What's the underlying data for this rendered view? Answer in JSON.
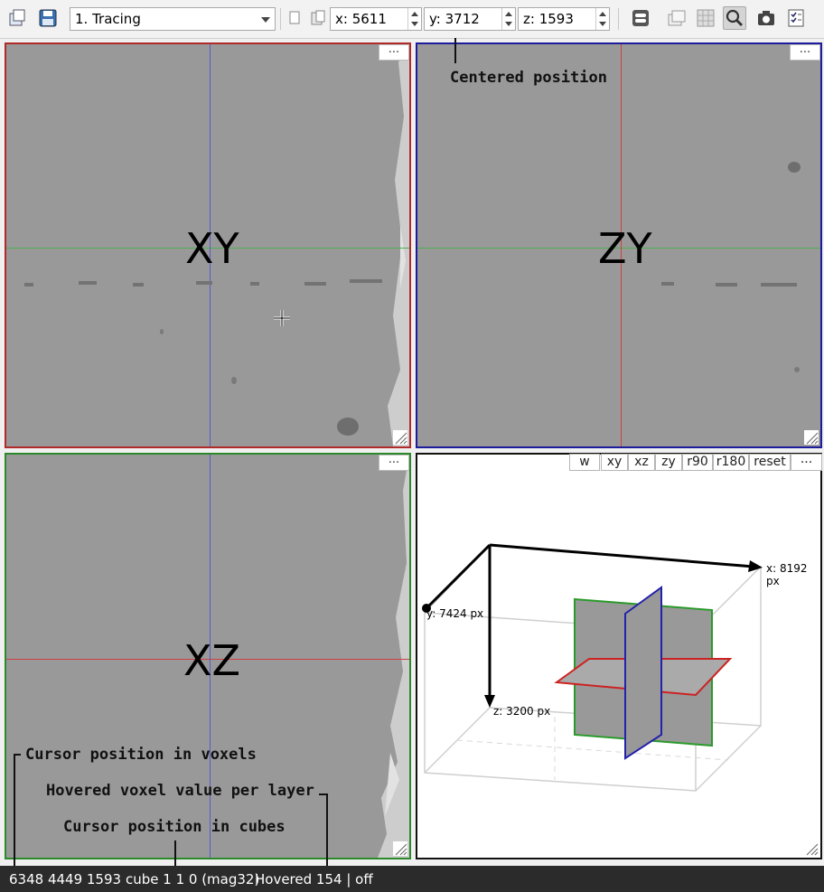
{
  "toolbar": {
    "mode_select": "1. Tracing",
    "x_field": "x: 5611",
    "y_field": "y: 3712",
    "z_field": "z: 1593"
  },
  "viewports": {
    "xy": {
      "label": "XY",
      "menu": "..."
    },
    "zy": {
      "label": "ZY",
      "menu": "..."
    },
    "xz": {
      "label": "XZ",
      "menu": "..."
    },
    "3d": {
      "buttons": [
        "w",
        "xy",
        "xz",
        "zy",
        "r90",
        "r180",
        "reset",
        "..."
      ],
      "axis_x": "x: 8192 px",
      "axis_y": "y: 7424 px",
      "axis_z": "z: 3200 px"
    }
  },
  "annotations": {
    "centered": "Centered position",
    "cursor_voxels": "Cursor position in voxels",
    "hovered": "Hovered voxel value per layer",
    "cursor_cubes": "Cursor position in cubes"
  },
  "statusbar": {
    "position": "6348 4449 1593",
    "cube": "cube 1 1 0 (mag32)",
    "hovered": "Hovered 154 | off"
  },
  "colors": {
    "xy_border": "#b02a2a",
    "zy_border": "#1c1c9c",
    "xz_border": "#2a8a2a",
    "accent_red": "#cc2222",
    "accent_green": "#22aa22",
    "accent_blue": "#2222cc"
  }
}
